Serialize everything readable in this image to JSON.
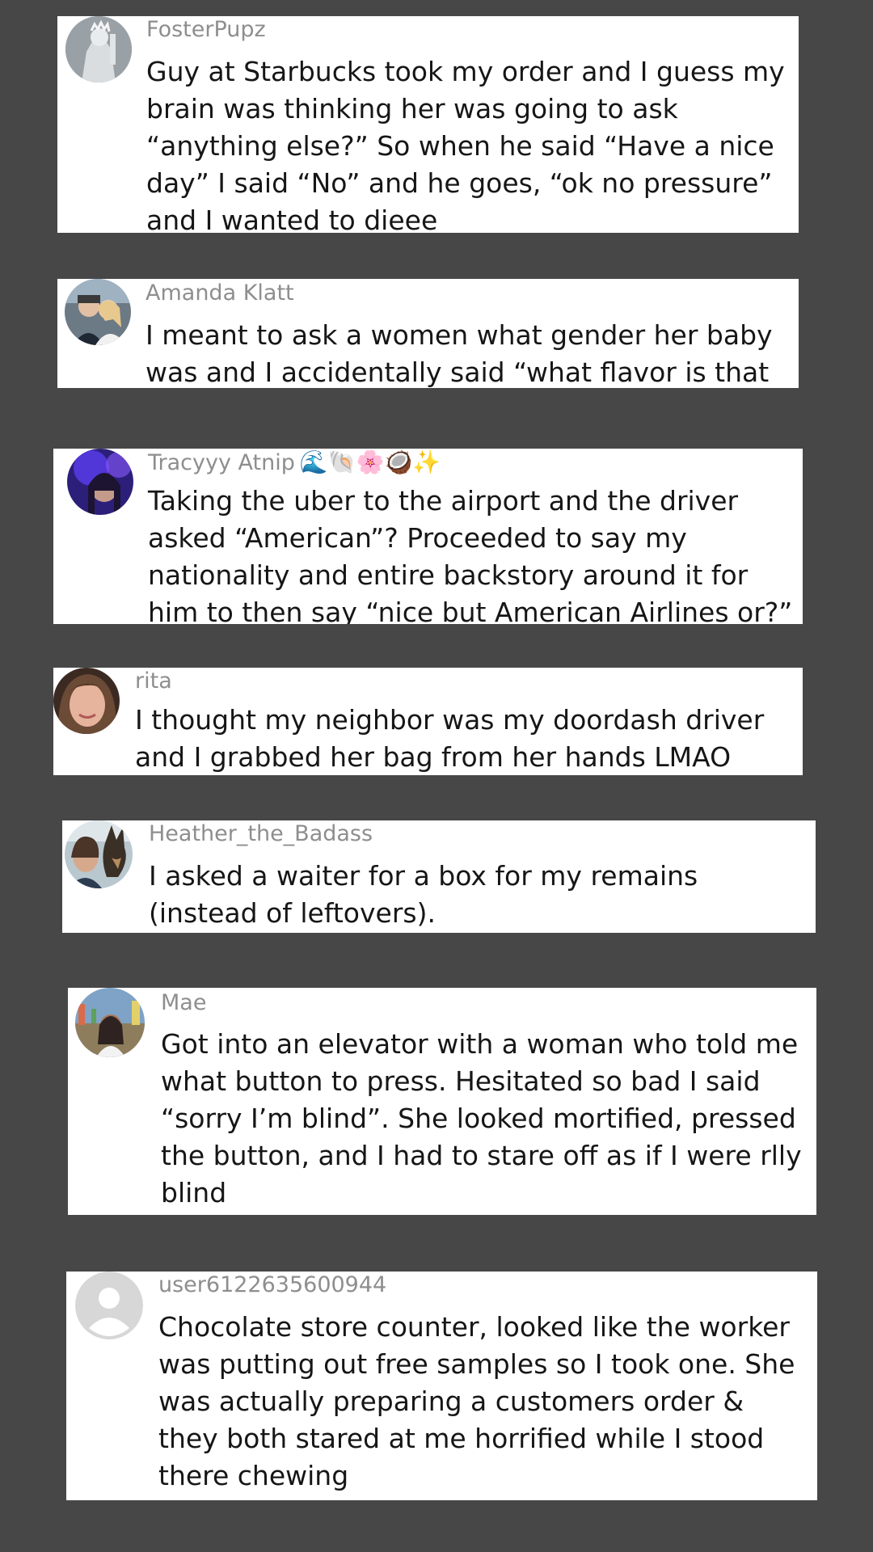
{
  "comments": [
    {
      "username": "FosterPupz",
      "text": "Guy at Starbucks took my order and I guess my brain was thinking her was going to ask “anything else?” So when he said “Have a nice day” I said “No” and he goes, “ok no pressure” and I wanted to dieee"
    },
    {
      "username": "Amanda Klatt",
      "text": "I meant to ask a women what gender her baby was and I accidentally said “what flavor is that baby”"
    },
    {
      "username": "Tracyyy Atnip",
      "username_emoji": "🌊🐚🌸🥥✨",
      "text": "Taking the uber to the airport and the driver asked “American”? Proceeded to say my nationality and entire backstory around it for him to then say “nice but American Airlines or?”",
      "text_emoji": "☠"
    },
    {
      "username": "rita",
      "text": "I thought my neighbor was my doordash driver and I grabbed her bag from her hands LMAO"
    },
    {
      "username": "Heather_the_Badass",
      "text": "I asked a waiter for a box for my remains (instead of leftovers)."
    },
    {
      "username": "Mae",
      "text": "Got into an elevator with a woman who told me what button to press. Hesitated so bad I said “sorry I’m blind”. She looked mortified, pressed the button, and I had to stare off as if I were rlly blind"
    },
    {
      "username": "user6122635600944",
      "text": "Chocolate store counter, looked like the worker was putting out free samples so I took one. She was actually preparing a customers order & they both stared at me horrified while I stood there chewing"
    }
  ]
}
